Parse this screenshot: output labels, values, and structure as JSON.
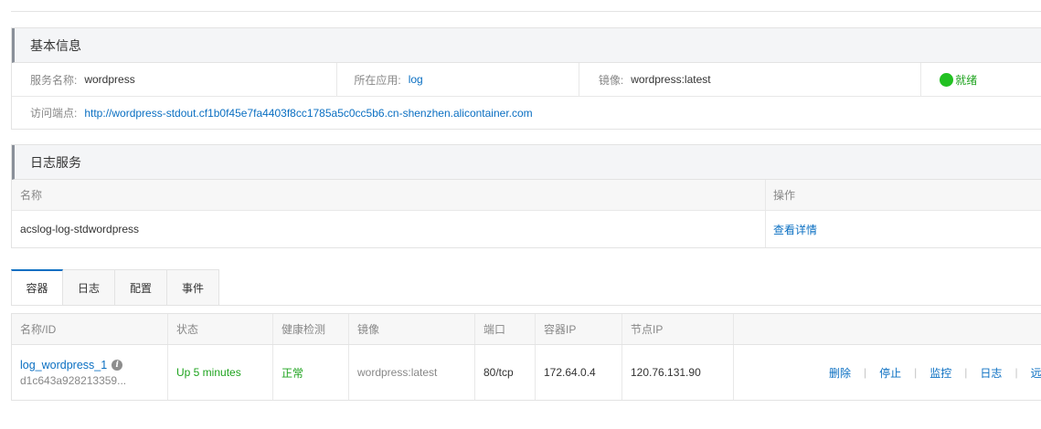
{
  "basic_info": {
    "title": "基本信息",
    "service_name_label": "服务名称:",
    "service_name": "wordpress",
    "app_label": "所在应用:",
    "app": "log",
    "image_label": "镜像:",
    "image": "wordpress:latest",
    "status": "就绪",
    "endpoint_label": "访问端点:",
    "endpoint": "http://wordpress-stdout.cf1b0f45e7fa4403f8cc1785a5c0cc5b6.cn-shenzhen.alicontainer.com"
  },
  "log_service": {
    "title": "日志服务",
    "columns": [
      "名称",
      "操作"
    ],
    "rows": [
      {
        "name": "acslog-log-stdwordpress",
        "action": "查看详情"
      }
    ]
  },
  "tabs": [
    "容器",
    "日志",
    "配置",
    "事件"
  ],
  "containers": {
    "columns": [
      "名称/ID",
      "状态",
      "健康检测",
      "镜像",
      "端口",
      "容器IP",
      "节点IP",
      ""
    ],
    "rows": [
      {
        "name": "log_wordpress_1",
        "id": "d1c643a928213359...",
        "status": "Up 5 minutes",
        "health": "正常",
        "image": "wordpress:latest",
        "port": "80/tcp",
        "container_ip": "172.64.0.4",
        "node_ip": "120.76.131.90",
        "actions": [
          "删除",
          "停止",
          "监控",
          "日志",
          "远"
        ]
      }
    ]
  },
  "colors": {
    "link": "#0a6fc2",
    "ok": "#1ea31e"
  }
}
